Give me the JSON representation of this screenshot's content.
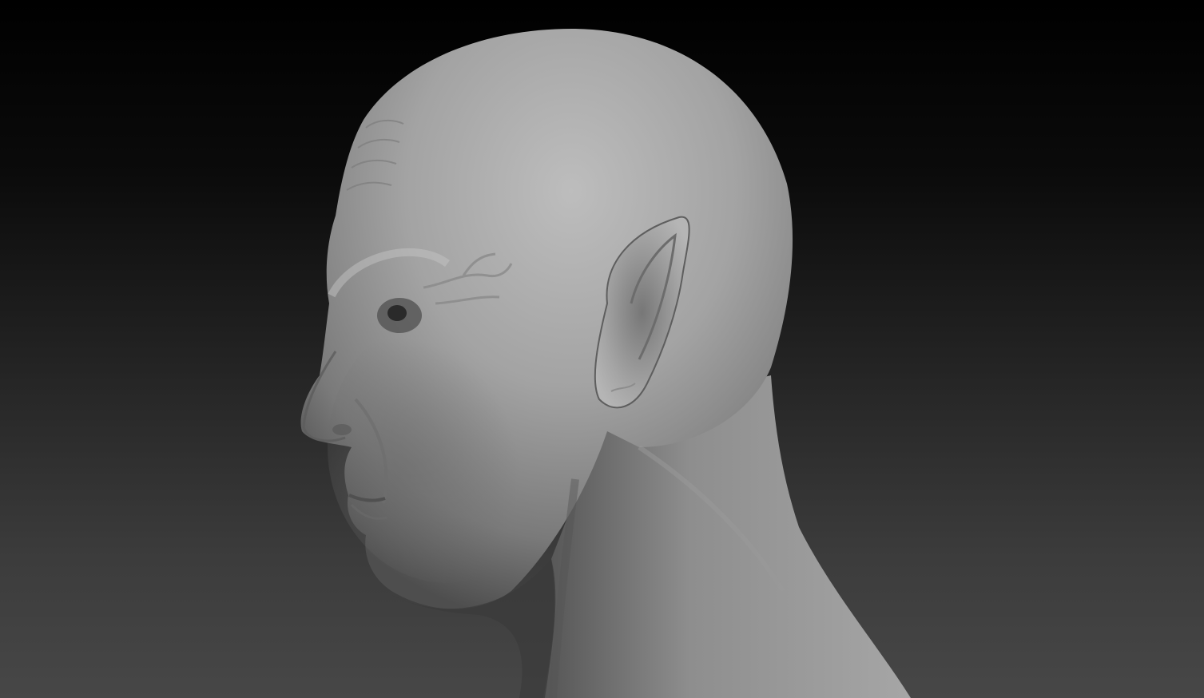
{
  "scene": {
    "subject": "sculpted-head-profile",
    "colors": {
      "background_top": "#000000",
      "background_bottom": "#474747",
      "clay_light": "#b8b8b8",
      "clay_mid": "#8c8c8c",
      "clay_dark": "#4a4a4a"
    }
  }
}
